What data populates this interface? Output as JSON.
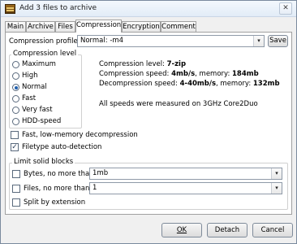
{
  "window": {
    "title": "Add 3 files to archive",
    "close_glyph": "✕"
  },
  "tabs": [
    "Main",
    "Archive",
    "Files",
    "Compression",
    "Encryption",
    "Comment"
  ],
  "compression": {
    "profile_label": "Compression profile:",
    "profile_value": "Normal: -m4",
    "save_label": "Save",
    "level_group_title": "Compression level",
    "levels": [
      "Maximum",
      "High",
      "Normal",
      "Fast",
      "Very fast",
      "HDD-speed"
    ],
    "selected_level": "Normal",
    "info": {
      "level_prefix": "Compression level: ",
      "level_value": "7-zip",
      "cspeed_prefix": "Compression speed: ",
      "cspeed_value": "4mb/s",
      "cspeed_mid": ", memory: ",
      "cmem_value": "184mb",
      "dspeed_prefix": "Decompression speed: ",
      "dspeed_value": "4-40mb/s",
      "dspeed_mid": ", memory: ",
      "dmem_value": "132mb",
      "note": "All speeds were measured on 3GHz Core2Duo"
    },
    "fast_lowmem_label": "Fast, low-memory decompression",
    "fast_lowmem_checked": false,
    "autodetect_label": "Filetype auto-detection",
    "autodetect_checked": true,
    "solid_group_title": "Limit solid blocks",
    "bytes_label": "Bytes, no more than:",
    "bytes_value": "1mb",
    "bytes_checked": false,
    "files_label": "Files, no more than:",
    "files_value": "1",
    "files_checked": false,
    "split_label": "Split by extension",
    "split_checked": false
  },
  "footer": {
    "ok_label": "OK",
    "detach_label": "Detach",
    "cancel_label": "Cancel"
  },
  "icons": {
    "dropdown_arrow": "▾",
    "check_mark": "✓"
  }
}
